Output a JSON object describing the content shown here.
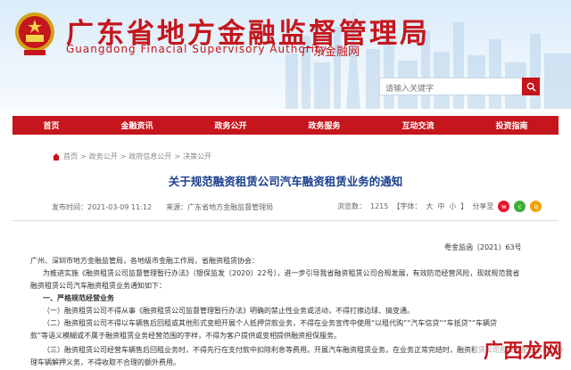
{
  "header": {
    "title_cn": "广东省地方金融监督管理局",
    "title_en": "Guangdong Finacial Supervisory Authority",
    "title_sub": "广东金融网",
    "search_placeholder": "请输入关键字"
  },
  "nav": {
    "items": [
      "首页",
      "金融资讯",
      "政务公开",
      "政务服务",
      "互动交流",
      "投资指南"
    ]
  },
  "breadcrumb": [
    "首页",
    "政务公开",
    "政府信息公开",
    "决策公开"
  ],
  "article": {
    "title": "关于规范融资租赁公司汽车融资租赁业务的通知",
    "date": "发布时间：2021-03-09 11:12",
    "source": "来源：广东省地方金融监督管理局",
    "views_label": "浏览数：",
    "views": "1215",
    "font_label": "【字体：",
    "font_large": "大",
    "font_medium": "中",
    "font_small": "小",
    "font_end": "】",
    "share_label": "分享至",
    "doc_no": "粤金监函〔2021〕63号",
    "paragraphs": [
      "广州、深圳市地方金融监管局，各地级市金融工作局，省融资租赁协会：",
      "为推进实施《融资租赁公司监督管理暂行办法》（银保监发〔2020〕22号），进一步引导我省融资租赁公司合规发展，有效防范经营风险，现就规范我省",
      "融资租赁公司汽车融资租赁业务通知如下：",
      "一、严格规范经营业务",
      "（一）融资租赁公司不得从事《融资租赁公司监督管理暂行办法》明确的禁止性业务或活动，不得打擦边球、搞变通。",
      "（二）融资租赁公司不得以车辆售后回租或其他形式变相开展个人抵押贷款业务，不得在业务宣传中使用“以租代购”“汽车信贷”“车抵贷”“车辆贷",
      "款”等语义模糊或不属于融资租赁业务经营范围的字样，不得为客户提供或变相提供融资担保服务。",
      "（三）融资租赁公司经营车辆售后回租业务时，不得先行在支付款中扣除利息等费用。开展汽车融资租赁业务，在业务正常完结时，融资租赁公司应及时配合承租人办",
      "理车辆解押义务，不得收取不合理的额外费用。"
    ]
  },
  "watermark": "广西龙网",
  "colors": {
    "brand_red": "#c4161c",
    "title_blue": "#1a3f8f"
  },
  "icons": {
    "home": "home-icon",
    "search": "search-icon",
    "share_weibo": "weibo-icon",
    "share_wechat": "wechat-icon",
    "share_qq": "qq-icon",
    "emblem": "national-emblem-icon"
  }
}
